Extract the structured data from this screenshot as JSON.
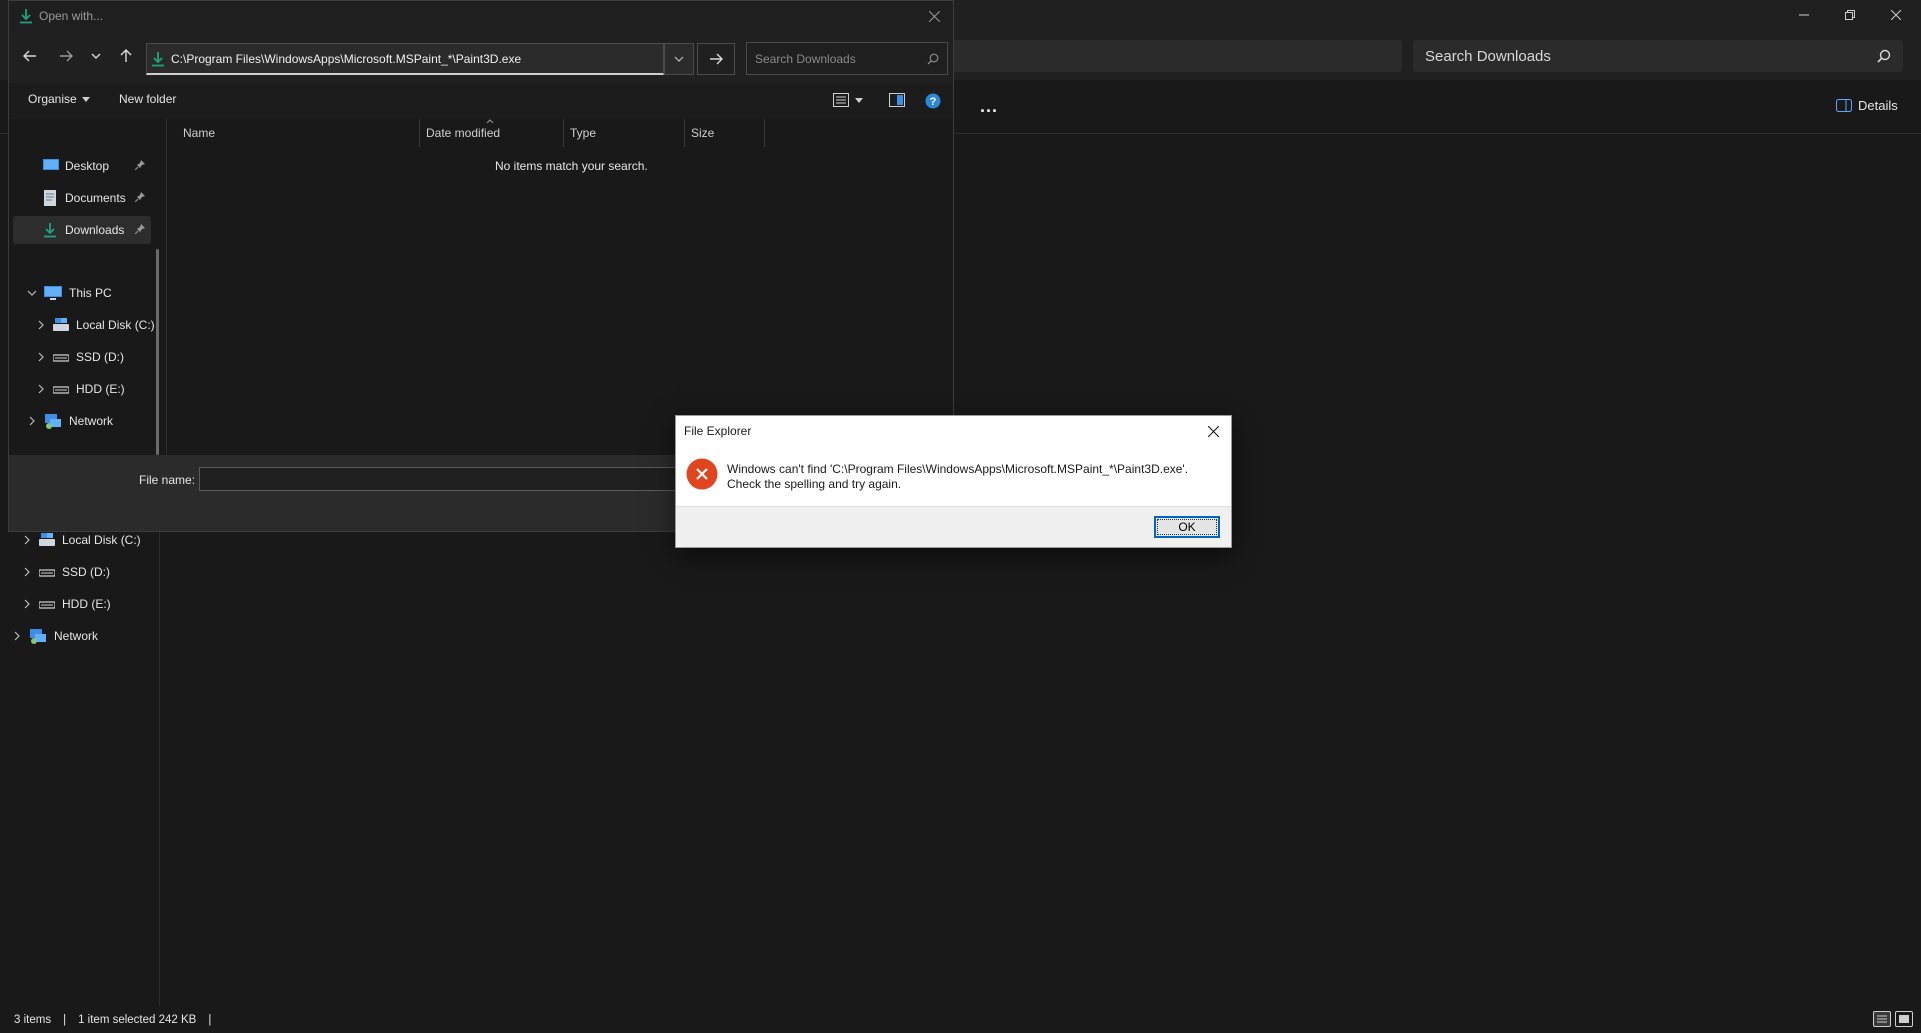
{
  "background_window": {
    "search_placeholder": "Search Downloads",
    "more_label": "...",
    "details_label": "Details",
    "nav_items": [
      {
        "label": "Local Disk (C:)"
      },
      {
        "label": "SSD (D:)"
      },
      {
        "label": "HDD (E:)"
      },
      {
        "label": "Network"
      }
    ],
    "status": {
      "items_count": "3 items",
      "selection": "1 item selected  242 KB"
    }
  },
  "open_with_dialog": {
    "title": "Open with...",
    "address": "C:\\Program Files\\WindowsApps\\Microsoft.MSPaint_*\\Paint3D.exe",
    "search_placeholder": "Search Downloads",
    "organise_label": "Organise",
    "new_folder_label": "New folder",
    "quick_access": [
      {
        "label": "Desktop",
        "icon": "desktop-icon"
      },
      {
        "label": "Documents",
        "icon": "documents-icon"
      },
      {
        "label": "Downloads",
        "icon": "downloads-icon"
      }
    ],
    "tree": {
      "this_pc": "This PC",
      "drives": [
        {
          "label": "Local Disk (C:)"
        },
        {
          "label": "SSD (D:)"
        },
        {
          "label": "HDD (E:)"
        }
      ],
      "network": "Network"
    },
    "columns": [
      "Name",
      "Date modified",
      "Type",
      "Size"
    ],
    "empty_message": "No items match your search.",
    "file_name_label": "File name:",
    "file_name_value": ""
  },
  "error_dialog": {
    "title": "File Explorer",
    "message_line1": "Windows can't find 'C:\\Program Files\\WindowsApps\\Microsoft.MSPaint_*\\Paint3D.exe'.",
    "message_line2": "Check the spelling and try again.",
    "ok_label": "OK"
  },
  "colors": {
    "accent": "#0067c0",
    "error_red": "#e0451f",
    "download_green": "#1fa37a",
    "background": "#191919"
  }
}
